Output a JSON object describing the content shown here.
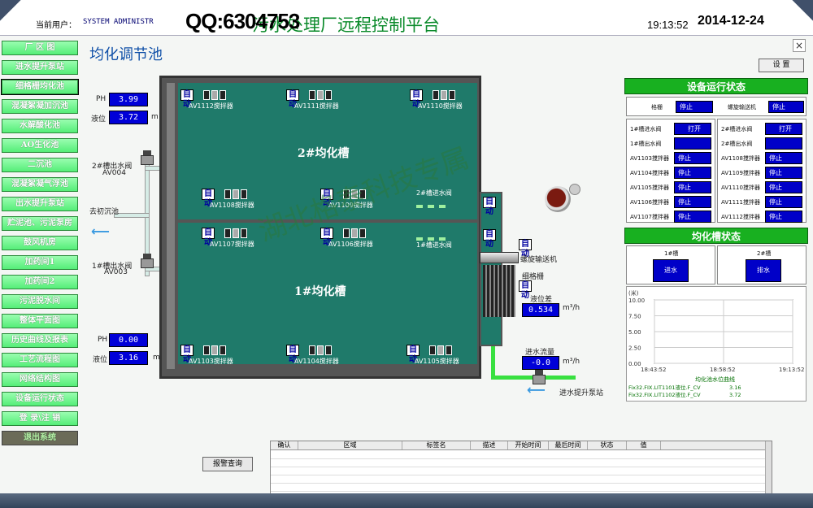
{
  "header": {
    "user_label": "当前用户：",
    "user_name": "SYSTEM ADMINISTR",
    "qq": "QQ:6304753",
    "title": "污水处理厂远程控制平台",
    "time": "19:13:52",
    "date": "2014-12-24"
  },
  "sidebar": {
    "items": [
      {
        "label": "厂 区 图"
      },
      {
        "label": "进水提升泵站"
      },
      {
        "label": "细格栅均化池"
      },
      {
        "label": "混凝絮凝加沉池"
      },
      {
        "label": "水解酸化池"
      },
      {
        "label": "AO生化池"
      },
      {
        "label": "二沉池"
      },
      {
        "label": "混凝絮凝气浮池"
      },
      {
        "label": "出水提升泵站"
      },
      {
        "label": "贮泥池、污泥泵房"
      },
      {
        "label": "鼓风机房"
      },
      {
        "label": "加药间1"
      },
      {
        "label": "加药间2"
      },
      {
        "label": "污泥脱水间"
      },
      {
        "label": "整体平面图"
      },
      {
        "label": "历史曲线及报表"
      },
      {
        "label": "工艺流程图"
      },
      {
        "label": "网络结构图"
      },
      {
        "label": "设备运行状态"
      },
      {
        "label": "登 录\\注 销"
      },
      {
        "label": "退出系统"
      }
    ]
  },
  "page_title": "均化调节池",
  "left_readouts": {
    "ph1_label": "PH",
    "ph1": "3.99",
    "level1_label": "液位",
    "level1": "3.72",
    "unit_m": "m",
    "ph2_label": "PH",
    "ph2": "0.00",
    "level2_label": "液位",
    "level2": "3.16"
  },
  "valves": {
    "v2_label": "2#槽出水阀",
    "v2_code": "AV004",
    "v1_label": "1#槽出水阀",
    "v1_code": "AV003",
    "to_sedimentation": "去初沉池"
  },
  "tank": {
    "upper_name": "2#均化槽",
    "lower_name": "1#均化槽",
    "auto": "自动",
    "mixers_upper_top": [
      "AV1112搅拌器",
      "AV1111搅拌器",
      "AV1110搅拌器"
    ],
    "mixers_upper_bottom": [
      "AV1108搅拌器",
      "AV1109搅拌器"
    ],
    "inlet2": "2#槽进水阀",
    "mixers_lower_top": [
      "AV1107搅拌器",
      "AV1106搅拌器"
    ],
    "inlet1": "1#槽进水阀",
    "mixers_lower_bottom": [
      "AV1103搅拌器",
      "AV1104搅拌器",
      "AV1105搅拌器"
    ]
  },
  "right_equipment": {
    "screw": "螺旋输送机",
    "fine_screen": "细格栅",
    "level_diff_label": "液位差",
    "level_diff": "0.534",
    "flow_label": "进水流量",
    "flow": "-0.0",
    "flow_unit": "m³/h",
    "pump_station": "进水提升泵站",
    "auto": "自动"
  },
  "panel": {
    "settings": "设 置",
    "run_status_title": "设备运行状态",
    "grid_label": "格栅",
    "grid_state": "停止",
    "screw_label": "螺旋输送机",
    "screw_state": "停止",
    "left_rows": [
      {
        "label": "1#槽进水阀",
        "state": "打开"
      },
      {
        "label": "1#槽出水阀",
        "state": ""
      },
      {
        "label": "AV1103搅拌器",
        "state": "停止"
      },
      {
        "label": "AV1104搅拌器",
        "state": "停止"
      },
      {
        "label": "AV1105搅拌器",
        "state": "停止"
      },
      {
        "label": "AV1106搅拌器",
        "state": "停止"
      },
      {
        "label": "AV1107搅拌器",
        "state": "停止"
      }
    ],
    "right_rows": [
      {
        "label": "2#槽进水阀",
        "state": "打开"
      },
      {
        "label": "2#槽出水阀",
        "state": ""
      },
      {
        "label": "AV1108搅拌器",
        "state": "停止"
      },
      {
        "label": "AV1109搅拌器",
        "state": "停止"
      },
      {
        "label": "AV1110搅拌器",
        "state": "停止"
      },
      {
        "label": "AV1111搅拌器",
        "state": "停止"
      },
      {
        "label": "AV1112搅拌器",
        "state": "停止"
      }
    ],
    "tank_status_title": "均化槽状态",
    "tank1_label": "1#槽",
    "tank1_state": "进水",
    "tank2_label": "2#槽",
    "tank2_state": "排水"
  },
  "chart_data": {
    "type": "line",
    "title": "均化池水位曲线",
    "ylabel": "(米)",
    "ylim": [
      0,
      10
    ],
    "y_ticks": [
      "10.00",
      "7.50",
      "5.00",
      "2.50",
      "0.00"
    ],
    "x_ticks": [
      "18:43:52",
      "18:58:52",
      "19:13:52"
    ],
    "legend": [
      {
        "tag": "Fix32.FIX.LIT1101液位.F_CV",
        "value": "3.16"
      },
      {
        "tag": "Fix32.FIX.LIT1102液位.F_CV",
        "value": "3.72"
      }
    ],
    "series": []
  },
  "alarm": {
    "button": "报警查询",
    "columns": [
      "确认",
      "区域",
      "标签名",
      "描述",
      "开始时间",
      "最后时间",
      "状态",
      "值"
    ]
  },
  "watermark": "湖北格泰科技专属"
}
